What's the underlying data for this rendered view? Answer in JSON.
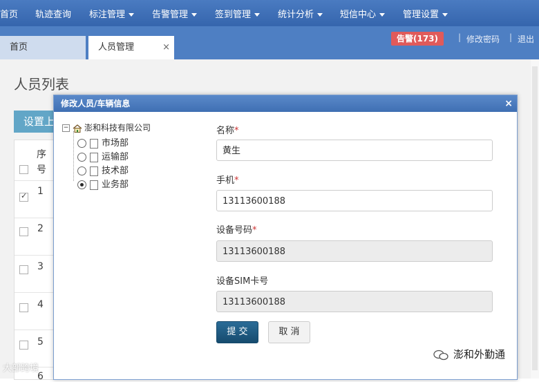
{
  "nav": {
    "items": [
      {
        "label": "首页",
        "dropdown": false
      },
      {
        "label": "轨迹查询",
        "dropdown": false
      },
      {
        "label": "标注管理",
        "dropdown": true
      },
      {
        "label": "告警管理",
        "dropdown": true
      },
      {
        "label": "签到管理",
        "dropdown": true
      },
      {
        "label": "统计分析",
        "dropdown": true
      },
      {
        "label": "短信中心",
        "dropdown": true
      },
      {
        "label": "管理设置",
        "dropdown": true
      }
    ]
  },
  "tabs": {
    "home": "首页",
    "active": "人员管理",
    "close": "×"
  },
  "header_right": {
    "alarm": "告警(173)",
    "change_password": "修改密码",
    "logout": "退出"
  },
  "page": {
    "title": "人员列表",
    "set_button": "设置上",
    "table": {
      "seq_header": "序号",
      "rows": [
        "1",
        "2",
        "3",
        "4",
        "5",
        "6"
      ]
    }
  },
  "modal": {
    "title": "修改人员/车辆信息",
    "close": "×",
    "tree": {
      "root": "澎和科技有限公司",
      "nodes": [
        {
          "label": "市场部",
          "selected": false
        },
        {
          "label": "运输部",
          "selected": false
        },
        {
          "label": "技术部",
          "selected": false
        },
        {
          "label": "业务部",
          "selected": true
        }
      ]
    },
    "form": {
      "name_label": "名称",
      "name_value": "黄生",
      "phone_label": "手机",
      "phone_value": "13113600188",
      "device_label": "设备号码",
      "device_value": "13113600188",
      "sim_label": "设备SIM卡号",
      "sim_value": "13113600188",
      "required_mark": "*",
      "submit": "提 交",
      "cancel": "取 消"
    }
  },
  "watermark": {
    "right": "澎和外勤通",
    "left": "大部跨境"
  },
  "colors": {
    "nav_bg": "#3c6eb4",
    "alarm_bg": "#e05a5a",
    "submit_bg": "#1f5d86",
    "modal_head": "#4a7bc1"
  }
}
